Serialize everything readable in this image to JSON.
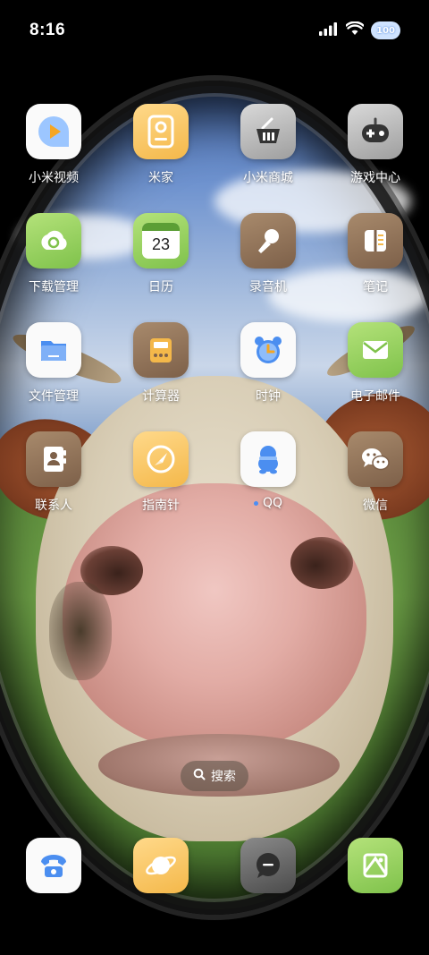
{
  "status_bar": {
    "time": "8:16",
    "battery": "100"
  },
  "apps": [
    [
      {
        "label": "小米视频",
        "icon": "play-icon",
        "bg": "white"
      },
      {
        "label": "米家",
        "icon": "mijia-icon",
        "bg": "yellow"
      },
      {
        "label": "小米商城",
        "icon": "shopping-basket-icon",
        "bg": "grey"
      },
      {
        "label": "游戏中心",
        "icon": "gamepad-icon",
        "bg": "grey"
      }
    ],
    [
      {
        "label": "下载管理",
        "icon": "download-icon",
        "bg": "green"
      },
      {
        "label": "日历",
        "icon": "calendar-icon",
        "bg": "green",
        "day": "23"
      },
      {
        "label": "录音机",
        "icon": "microphone-icon",
        "bg": "brown"
      },
      {
        "label": "笔记",
        "icon": "notes-icon",
        "bg": "brown"
      }
    ],
    [
      {
        "label": "文件管理",
        "icon": "folder-icon",
        "bg": "white"
      },
      {
        "label": "计算器",
        "icon": "calculator-icon",
        "bg": "brown"
      },
      {
        "label": "时钟",
        "icon": "alarm-clock-icon",
        "bg": "white"
      },
      {
        "label": "电子邮件",
        "icon": "mail-icon",
        "bg": "green"
      }
    ],
    [
      {
        "label": "联系人",
        "icon": "contacts-icon",
        "bg": "brown"
      },
      {
        "label": "指南针",
        "icon": "compass-icon",
        "bg": "yellow"
      },
      {
        "label": "QQ",
        "icon": "qq-penguin-icon",
        "bg": "white",
        "new_dot": true
      },
      {
        "label": "微信",
        "icon": "wechat-icon",
        "bg": "brown"
      }
    ]
  ],
  "search": {
    "label": "搜索",
    "icon": "search-icon"
  },
  "dock": [
    {
      "icon": "phone-icon",
      "bg": "white"
    },
    {
      "icon": "browser-planet-icon",
      "bg": "yellow"
    },
    {
      "icon": "messages-icon",
      "bg": "dark"
    },
    {
      "icon": "gallery-icon",
      "bg": "green"
    }
  ],
  "colors": {
    "accent_blue": "#4a8ef5",
    "yellow": "#f4b84a",
    "green": "#7fc24b",
    "brown": "#7d6049"
  }
}
